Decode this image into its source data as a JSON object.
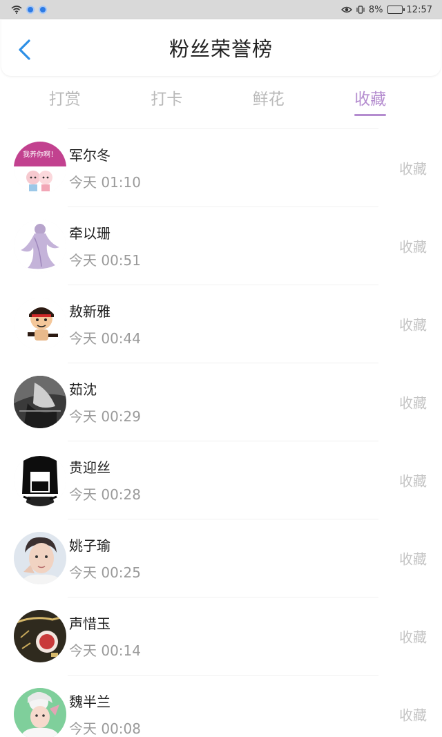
{
  "status_bar": {
    "battery": "8%",
    "time": "12:57"
  },
  "header": {
    "title": "粉丝荣誉榜"
  },
  "tabs": [
    {
      "label": "打赏",
      "active": false
    },
    {
      "label": "打卡",
      "active": false
    },
    {
      "label": "鲜花",
      "active": false
    },
    {
      "label": "收藏",
      "active": true
    }
  ],
  "avatar_1_text": "我养你啊！",
  "list": [
    {
      "name": "军尔冬",
      "time": "今天 01:10",
      "action": "收藏"
    },
    {
      "name": "牵以珊",
      "time": "今天 00:51",
      "action": "收藏"
    },
    {
      "name": "敖新雅",
      "time": "今天 00:44",
      "action": "收藏"
    },
    {
      "name": "茹沈",
      "time": "今天 00:29",
      "action": "收藏"
    },
    {
      "name": "贵迎丝",
      "time": "今天 00:28",
      "action": "收藏"
    },
    {
      "name": "姚子瑜",
      "time": "今天 00:25",
      "action": "收藏"
    },
    {
      "name": "声惜玉",
      "time": "今天 00:14",
      "action": "收藏"
    },
    {
      "name": "魏半兰",
      "time": "今天 00:08",
      "action": "收藏"
    }
  ],
  "colors": {
    "accent": "#b48ccf",
    "inactive_tab": "#b9b9b9",
    "secondary_text": "#9a9a9a",
    "action_text": "#c4c4c4",
    "back_arrow": "#2d8fe6"
  }
}
